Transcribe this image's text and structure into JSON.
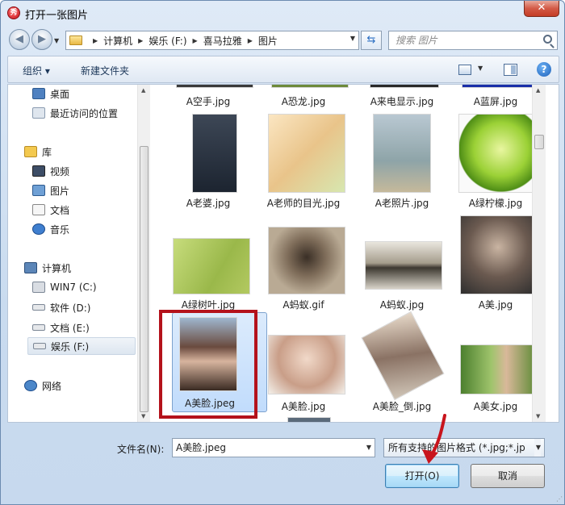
{
  "window": {
    "title": "打开一张图片",
    "close": "✕"
  },
  "nav": {
    "breadcrumbs": [
      "计算机",
      "娱乐 (F:)",
      "喜马拉雅",
      "图片"
    ],
    "search_placeholder": "搜索 图片"
  },
  "toolbar": {
    "organize": "组织 ▾",
    "new_folder": "新建文件夹",
    "help": "?"
  },
  "sidebar": {
    "items": [
      {
        "label": "桌面",
        "icon": "desktop-icon"
      },
      {
        "label": "最近访问的位置",
        "icon": "recent-places-icon"
      },
      {
        "label": "库",
        "icon": "library-icon"
      },
      {
        "label": "视频",
        "icon": "video-library-icon"
      },
      {
        "label": "图片",
        "icon": "pictures-library-icon"
      },
      {
        "label": "文档",
        "icon": "documents-library-icon"
      },
      {
        "label": "音乐",
        "icon": "music-library-icon"
      },
      {
        "label": "计算机",
        "icon": "computer-icon"
      },
      {
        "label": "WIN7 (C:)",
        "icon": "drive-icon"
      },
      {
        "label": "软件 (D:)",
        "icon": "drive-icon"
      },
      {
        "label": "文档 (E:)",
        "icon": "drive-icon"
      },
      {
        "label": "娱乐 (F:)",
        "icon": "drive-icon"
      },
      {
        "label": "网络",
        "icon": "network-icon"
      }
    ]
  },
  "files": [
    {
      "name": "A空手.jpg",
      "color": "#3a3a3a"
    },
    {
      "name": "A恐龙.jpg",
      "color": "#6d8a3a"
    },
    {
      "name": "A来电显示.jpg",
      "color": "#2a2a2a"
    },
    {
      "name": "A蓝屏.jpg",
      "color": "#1a2fa8"
    },
    {
      "name": "A老婆.jpg",
      "color": "#2b3440"
    },
    {
      "name": "A老师的目光.jpg",
      "color": "#f2d7a8"
    },
    {
      "name": "A老照片.jpg",
      "color": "#a3b4bc"
    },
    {
      "name": "A绿柠檬.jpg",
      "color": "#7dbb2a"
    },
    {
      "name": "A绿树叶.jpg",
      "color": "#a9c65a"
    },
    {
      "name": "A蚂蚁.gif",
      "color": "#6a5a48"
    },
    {
      "name": "A蚂蚁.jpg",
      "color": "#8a8578"
    },
    {
      "name": "A美.jpg",
      "color": "#5a5a5a"
    },
    {
      "name": "A美脸.jpeg",
      "color": "#8a6a58"
    },
    {
      "name": "A美脸.jpg",
      "color": "#d8b7a5"
    },
    {
      "name": "A美脸_倒.jpg",
      "color": "#8f7a70"
    },
    {
      "name": "A美女.jpg",
      "color": "#6f9a48"
    }
  ],
  "footer": {
    "filename_label": "文件名(N):",
    "filename_value": "A美脸.jpeg",
    "filter": "所有支持的图片格式 (*.jpg;*.jp",
    "open": "打开(O)",
    "cancel": "取消"
  }
}
